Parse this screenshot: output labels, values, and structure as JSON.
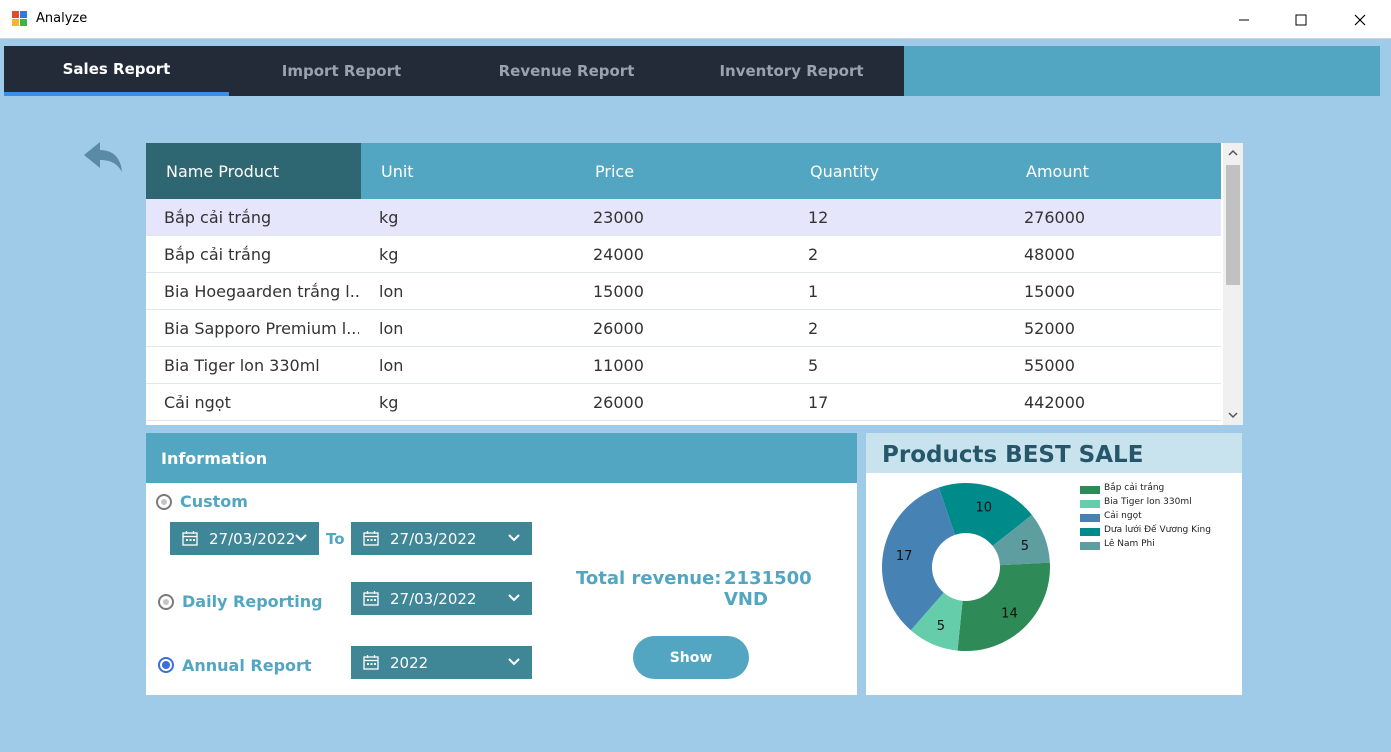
{
  "window": {
    "title": "Analyze"
  },
  "tabs": [
    {
      "label": "Sales Report",
      "active": true
    },
    {
      "label": "Import Report",
      "active": false
    },
    {
      "label": "Revenue Report",
      "active": false
    },
    {
      "label": "Inventory Report",
      "active": false
    }
  ],
  "table": {
    "columns": [
      "Name Product",
      "Unit",
      "Price",
      "Quantity",
      "Amount"
    ],
    "rows": [
      [
        "Bắp cải trắng",
        "kg",
        "23000",
        "12",
        "276000"
      ],
      [
        "Bắp cải trắng",
        "kg",
        "24000",
        "2",
        "48000"
      ],
      [
        "Bia Hoegaarden trắng l...",
        "lon",
        "15000",
        "1",
        "15000"
      ],
      [
        "Bia Sapporo Premium l...",
        "lon",
        "26000",
        "2",
        "52000"
      ],
      [
        "Bia Tiger lon 330ml",
        "lon",
        "11000",
        "5",
        "55000"
      ],
      [
        "Cải ngọt",
        "kg",
        "26000",
        "17",
        "442000"
      ]
    ],
    "selected_row": 0
  },
  "info": {
    "header": "Information",
    "custom": {
      "label": "Custom",
      "from": "27/03/2022",
      "to_label": "To",
      "to": "27/03/2022",
      "selected": false
    },
    "daily": {
      "label": "Daily Reporting",
      "date": "27/03/2022",
      "selected": false
    },
    "annual": {
      "label": "Annual Report",
      "year": "2022",
      "selected": true
    },
    "total_label": "Total revenue:",
    "total_value": "2131500 VND",
    "show_label": "Show"
  },
  "chart": {
    "title": "Products BEST SALE",
    "colors": [
      "#2e8b57",
      "#66cdaa",
      "#4682b4",
      "#008b8b",
      "#5f9ea0"
    ]
  },
  "chart_data": {
    "type": "pie",
    "title": "Products BEST SALE",
    "categories": [
      "Bắp cải trắng",
      "Bia Tiger lon 330ml",
      "Cải ngọt",
      "Dưa lưới Đế Vương King",
      "Lê Nam Phi"
    ],
    "values": [
      14,
      5,
      17,
      10,
      5
    ],
    "legend": "right"
  }
}
